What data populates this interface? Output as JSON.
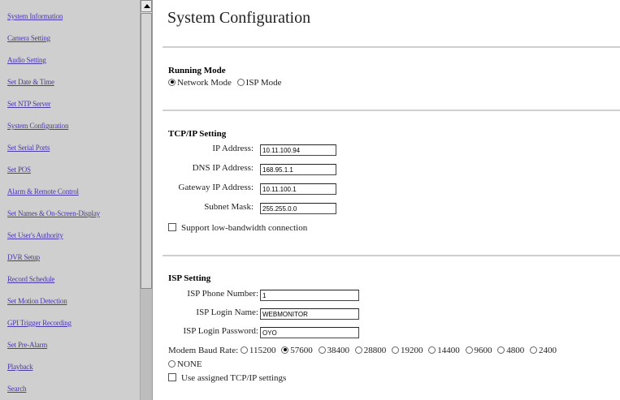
{
  "sidebar": {
    "items": [
      {
        "label": "System Information"
      },
      {
        "label": "Camera Setting"
      },
      {
        "label": "Audio Setting"
      },
      {
        "label": "Set Date & Time"
      },
      {
        "label": "Set NTP Server"
      },
      {
        "label": "System Configuration"
      },
      {
        "label": "Set Serial Ports"
      },
      {
        "label": "Set POS"
      },
      {
        "label": "Alarm & Remote Control"
      },
      {
        "label": "Set Names & On-Screen-Display"
      },
      {
        "label": "Set User's Authority"
      },
      {
        "label": "DVR Setup"
      },
      {
        "label": "Record Schedule"
      },
      {
        "label": "Set Motion Detection"
      },
      {
        "label": "GPI Trigger Recording"
      },
      {
        "label": "Set Pre-Alarm"
      },
      {
        "label": "Playback"
      },
      {
        "label": "Search"
      }
    ]
  },
  "page": {
    "title": "System Configuration"
  },
  "running_mode": {
    "heading": "Running Mode",
    "network_label": "Network Mode",
    "isp_label": "ISP Mode",
    "selected": "Network Mode"
  },
  "tcpip": {
    "heading": "TCP/IP Setting",
    "ip_label": "IP Address:",
    "ip_value": "10.11.100.94",
    "dns_label": "DNS IP Address:",
    "dns_value": "168.95.1.1",
    "gateway_label": "Gateway IP Address:",
    "gateway_value": "10.11.100.1",
    "subnet_label": "Subnet Mask:",
    "subnet_value": "255.255.0.0",
    "lowbw_label": "Support low-bandwidth connection",
    "lowbw_checked": false
  },
  "isp": {
    "heading": "ISP Setting",
    "phone_label": "ISP Phone Number:",
    "phone_value": "1",
    "login_label": "ISP Login Name:",
    "login_value": "WEBMONITOR",
    "password_label": "ISP Login Password:",
    "password_value": "OYO",
    "baud_label": "Modem Baud Rate:",
    "baud_options": [
      "115200",
      "57600",
      "38400",
      "28800",
      "19200",
      "14400",
      "9600",
      "4800",
      "2400",
      "NONE"
    ],
    "baud_selected": "57600",
    "assigned_label": "Use assigned TCP/IP settings",
    "assigned_checked": false
  }
}
